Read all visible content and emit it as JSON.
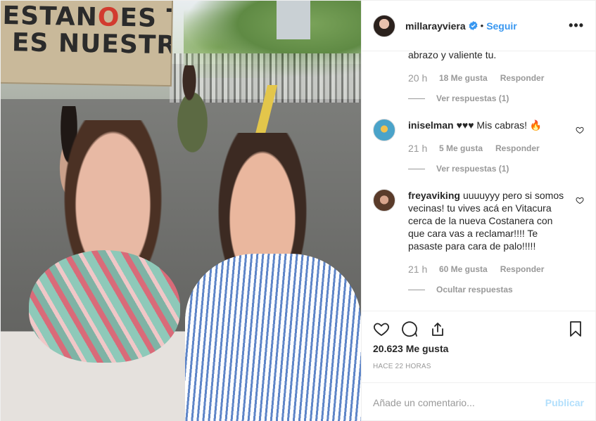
{
  "photo": {
    "sign_line1_a": "ESTAN",
    "sign_line1_b": "O",
    "sign_line1_c": "ES TU",
    "sign_line2": "ES NUESTRA"
  },
  "header": {
    "username": "millarayviera",
    "follow_label": "Seguir",
    "separator": "•",
    "more_label": "•••"
  },
  "comments": {
    "continuation": {
      "text": "abrazo y valiente tu.",
      "time": "20 h",
      "likes": "18 Me gusta",
      "reply": "Responder",
      "replies_link": "Ver respuestas (1)"
    },
    "items": [
      {
        "username": "iniselman",
        "text": "♥♥♥ Mis cabras! 🔥",
        "time": "21 h",
        "likes": "5 Me gusta",
        "reply": "Responder",
        "replies_link": "Ver respuestas (1)"
      },
      {
        "username": "freyaviking",
        "text": "uuuuyyy pero si somos vecinas! tu vives acá en Vitacura cerca de la nueva Costanera con que cara vas a reclamar!!!! Te pasaste para cara de palo!!!!!",
        "time": "21 h",
        "likes": "60 Me gusta",
        "reply": "Responder",
        "replies_link": "Ocultar respuestas"
      }
    ]
  },
  "likes_total": "20.623 Me gusta",
  "posted_ago": "HACE 22 HORAS",
  "add_comment": {
    "placeholder": "Añade un comentario...",
    "publish_label": "Publicar"
  },
  "colors": {
    "link_blue": "#3897f0",
    "publish_disabled": "#b2dffc",
    "muted": "#999999",
    "text": "#262626"
  },
  "icons": [
    "verified-badge-icon",
    "heart-icon",
    "comment-icon",
    "share-icon",
    "bookmark-icon",
    "more-icon",
    "small-heart-icon"
  ]
}
